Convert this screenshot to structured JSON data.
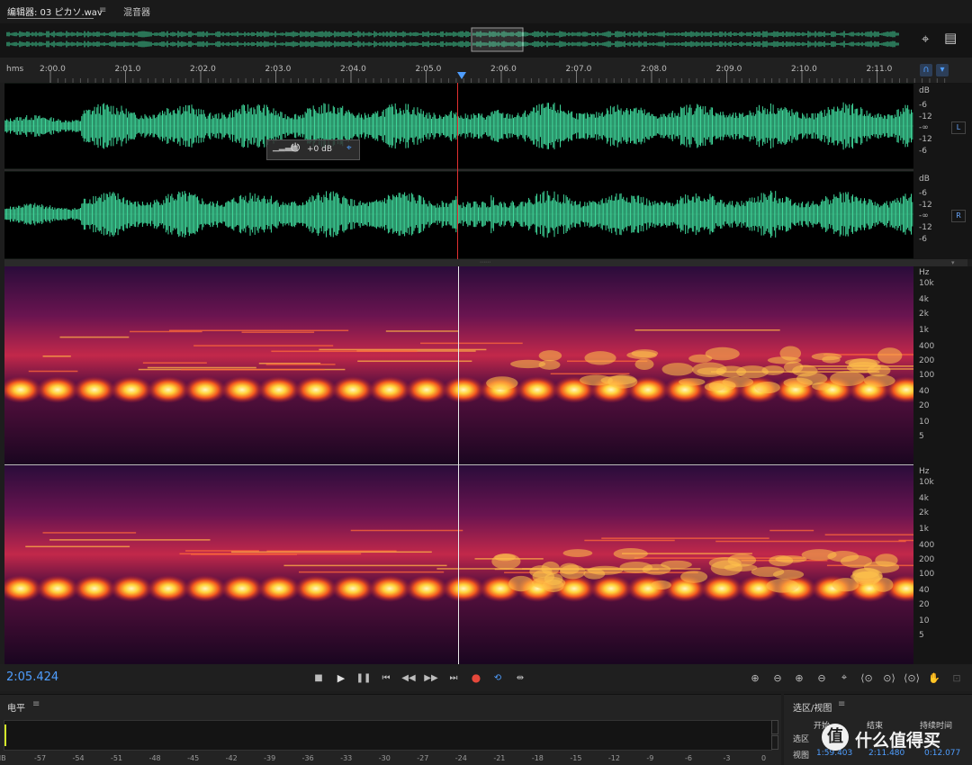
{
  "tabs": {
    "editor_label": "编辑器: 03 ピカソ.wav",
    "menu_icon": "menu-icon",
    "mixer_label": "混音器"
  },
  "ruler": {
    "unit_label": "hms",
    "ticks": [
      "2:00.0",
      "2:01.0",
      "2:02.0",
      "2:03.0",
      "2:04.0",
      "2:05.0",
      "2:06.0",
      "2:07.0",
      "2:08.0",
      "2:09.0",
      "2:10.0",
      "2:11.0"
    ]
  },
  "waveform": {
    "channel_left_label": "L",
    "channel_right_label": "R",
    "scale_left": [
      "dB",
      "-6",
      "-12",
      "-∞",
      "-12",
      "-6"
    ],
    "scale_right": [
      "dB",
      "-6",
      "-12",
      "-∞",
      "-12",
      "-6"
    ],
    "hud_gain_label": "+0 dB"
  },
  "spectral": {
    "scale_top": [
      "Hz",
      "10k",
      "4k",
      "2k",
      "1k",
      "400",
      "200",
      "100",
      "40",
      "20",
      "10",
      "5"
    ],
    "scale_bottom": [
      "Hz",
      "10k",
      "4k",
      "2k",
      "1k",
      "400",
      "200",
      "100",
      "40",
      "20",
      "10",
      "5"
    ]
  },
  "transport": {
    "current_time": "2:05.424"
  },
  "level_panel": {
    "title": "电平",
    "menu_icon": "menu-icon",
    "scale": [
      "dB",
      "-57",
      "-54",
      "-51",
      "-48",
      "-45",
      "-42",
      "-39",
      "-36",
      "-33",
      "-30",
      "-27",
      "-24",
      "-21",
      "-18",
      "-15",
      "-12",
      "-9",
      "-6",
      "-3",
      "0"
    ]
  },
  "selection_panel": {
    "title": "选区/视图",
    "menu_icon": "menu-icon",
    "col_start": "开始",
    "col_end": "结束",
    "col_duration": "持续时间",
    "row_selection": "选区",
    "row_view": "视图",
    "view_start": "1:59.403",
    "view_end": "2:11.480",
    "view_duration": "0:12.077",
    "watermark": "什么值得买"
  },
  "colors": {
    "waveform": "#3fd69a",
    "accent": "#4f9eff",
    "playhead": "#e23030",
    "record": "#e5483b"
  }
}
